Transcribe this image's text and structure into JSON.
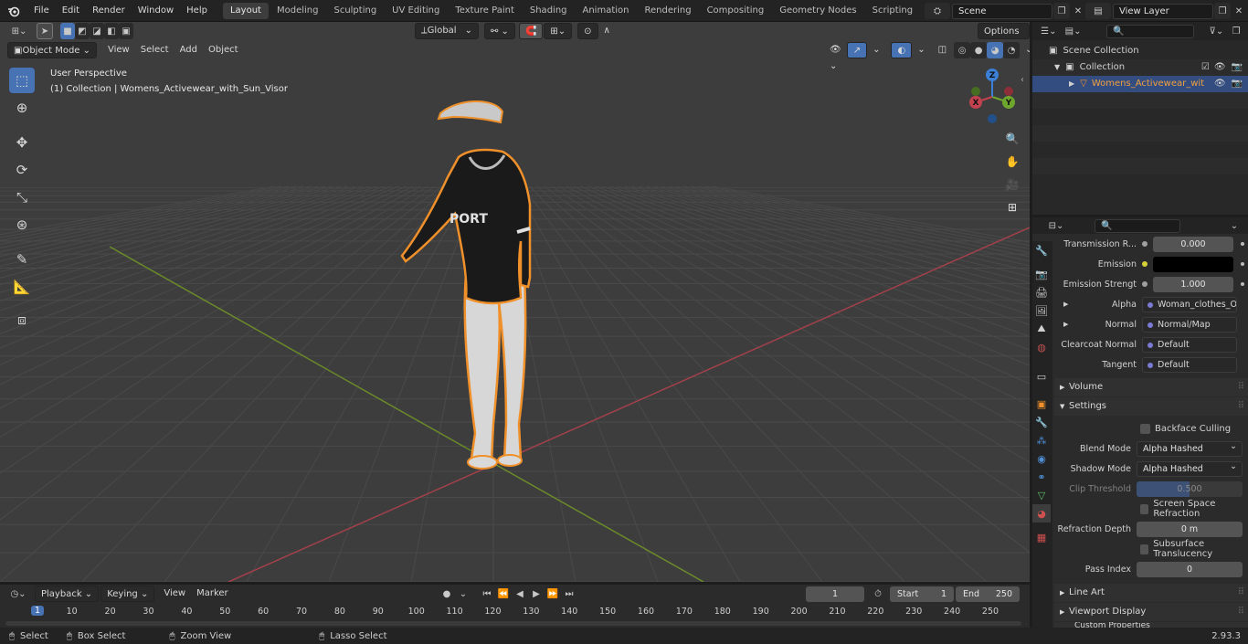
{
  "topbar": {
    "menus": [
      "File",
      "Edit",
      "Render",
      "Window",
      "Help"
    ],
    "workspaces": [
      "Layout",
      "Modeling",
      "Sculpting",
      "UV Editing",
      "Texture Paint",
      "Shading",
      "Animation",
      "Rendering",
      "Compositing",
      "Geometry Nodes",
      "Scripting"
    ],
    "active_workspace": "Layout",
    "add_tab": "+",
    "scene": "Scene",
    "view_layer": "View Layer"
  },
  "viewport": {
    "transform_orientation": "Global",
    "options_label": "Options",
    "mode": "Object Mode",
    "menus": [
      "View",
      "Select",
      "Add",
      "Object"
    ],
    "perspective_label": "User Perspective",
    "collection_label": "(1) Collection | Womens_Activewear_with_Sun_Visor",
    "axis_x": "X",
    "axis_y": "Y",
    "axis_z": "Z",
    "shirt_text": "PORT"
  },
  "outliner": {
    "search_placeholder": "",
    "scene_collection": "Scene Collection",
    "collection": "Collection",
    "object": "Womens_Activewear_wit"
  },
  "properties": {
    "search_placeholder": "",
    "rows": [
      {
        "label": "Transmission R...",
        "value": "0.000"
      },
      {
        "label": "Emission Strengt",
        "value": "1.000"
      }
    ],
    "emission_label": "Emission",
    "emission_color": "#000000",
    "links": [
      {
        "label": "Alpha",
        "value": "Woman_clothes_Op..."
      },
      {
        "label": "Normal",
        "value": "Normal/Map"
      },
      {
        "label": "Clearcoat Normal",
        "value": "Default"
      },
      {
        "label": "Tangent",
        "value": "Default"
      }
    ],
    "volume_header": "Volume",
    "settings_header": "Settings",
    "backface_culling": "Backface Culling",
    "blend_mode_label": "Blend Mode",
    "blend_mode_value": "Alpha Hashed",
    "shadow_mode_label": "Shadow Mode",
    "shadow_mode_value": "Alpha Hashed",
    "clip_threshold_label": "Clip Threshold",
    "clip_threshold_value": "0.500",
    "screen_space_refraction": "Screen Space Refraction",
    "refraction_depth_label": "Refraction Depth",
    "refraction_depth_value": "0 m",
    "subsurface_translucency": "Subsurface Translucency",
    "pass_index_label": "Pass Index",
    "pass_index_value": "0",
    "line_art_header": "Line Art",
    "viewport_display_header": "Viewport Display",
    "custom_props_header": "Custom Properties"
  },
  "timeline": {
    "menus": [
      "Playback",
      "Keying",
      "View",
      "Marker"
    ],
    "current_frame": "1",
    "start_label": "Start",
    "start_value": "1",
    "end_label": "End",
    "end_value": "250",
    "ticks": [
      "1",
      "10",
      "20",
      "30",
      "40",
      "50",
      "60",
      "70",
      "80",
      "90",
      "100",
      "110",
      "120",
      "130",
      "140",
      "150",
      "160",
      "170",
      "180",
      "190",
      "200",
      "210",
      "220",
      "230",
      "240",
      "250"
    ]
  },
  "statusbar": {
    "select": "Select",
    "box_select": "Box Select",
    "zoom_view": "Zoom View",
    "lasso_select": "Lasso Select",
    "version": "2.93.3"
  },
  "colors": {
    "accent": "#4772b3",
    "selection_outline": "#f0902a",
    "x_axis": "#c2424f",
    "y_axis": "#6ea62e",
    "z_axis": "#3b7fd6",
    "object_highlight": "#334d80"
  }
}
